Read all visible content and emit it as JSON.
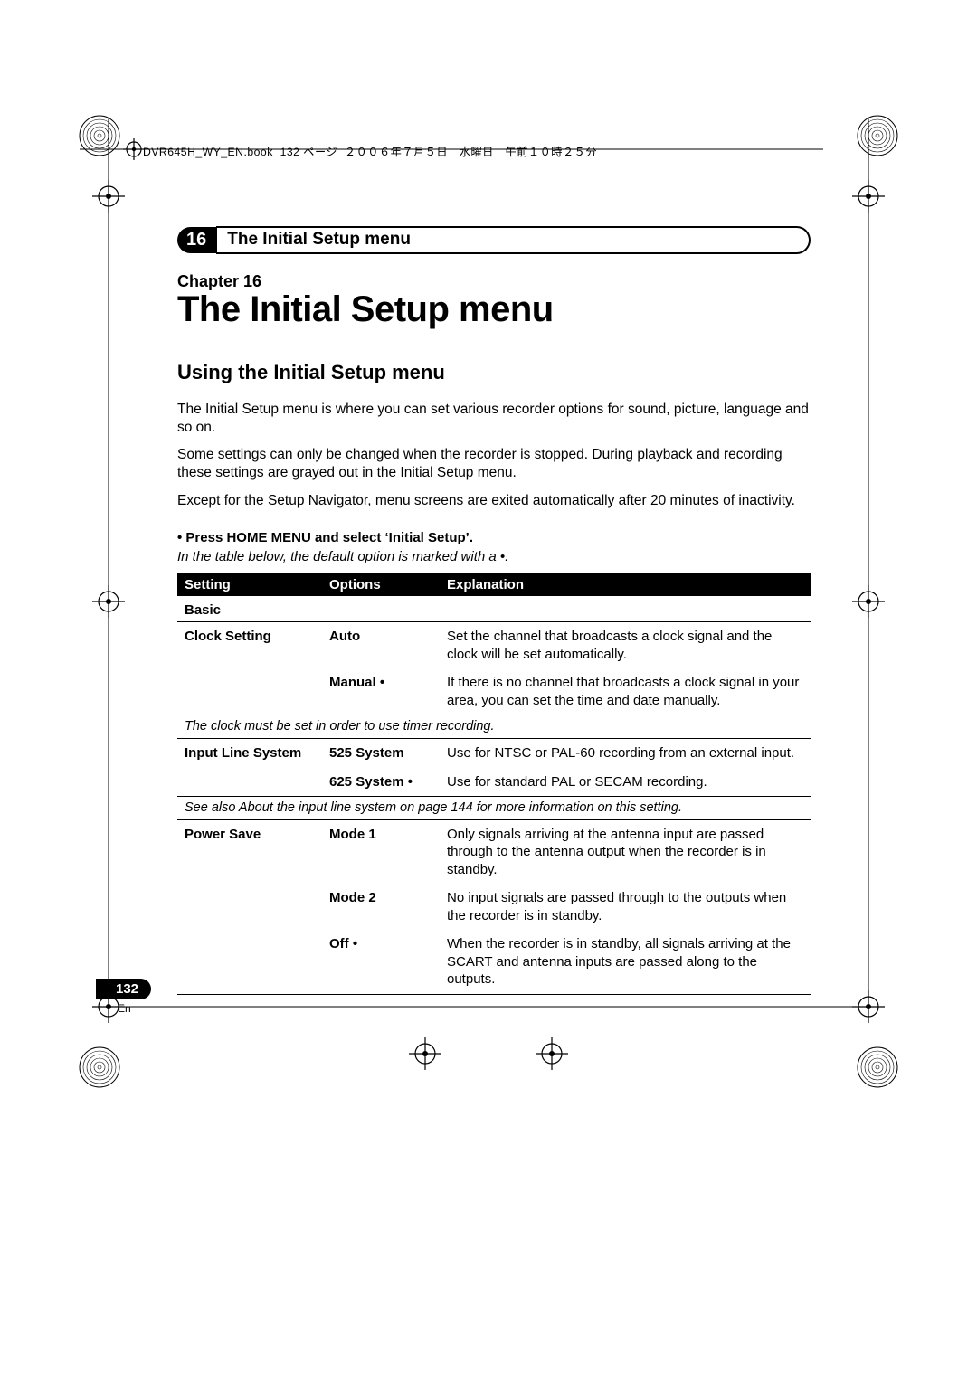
{
  "meta": {
    "book_line": "DVR645H_WY_EN.book  132 ページ  ２００６年７月５日　水曜日　午前１０時２５分"
  },
  "header": {
    "chapter_number": "16",
    "chapter_breadcrumb": "The Initial Setup menu",
    "chapter_label": "Chapter 16",
    "chapter_title": "The Initial Setup menu"
  },
  "section": {
    "title": "Using the Initial Setup menu",
    "paragraphs": [
      "The Initial Setup menu is where you can set various recorder options for sound, picture, language and so on.",
      "Some settings can only be changed when the recorder is stopped. During playback and recording these settings are grayed out in the Initial Setup menu.",
      "Except for the Setup Navigator, menu screens are exited automatically after 20 minutes of inactivity."
    ],
    "bullet": "•   Press HOME MENU and select ‘Initial Setup’.",
    "table_note": "In the table below, the default option is marked with a  •."
  },
  "table": {
    "columns": [
      "Setting",
      "Options",
      "Explanation"
    ],
    "section_basic": "Basic",
    "rows": {
      "clock": {
        "label": "Clock Setting",
        "opt_auto": "Auto",
        "exp_auto": "Set the channel that broadcasts a clock signal and the clock will be set automatically.",
        "opt_manual": "Manual •",
        "exp_manual": "If there is no channel that broadcasts a clock signal in your area, you can set the time and date manually.",
        "note": "The clock must be set in order to use timer recording."
      },
      "input_line": {
        "label": "Input Line System",
        "opt_525": "525 System",
        "exp_525": "Use for NTSC or PAL-60 recording from an external input.",
        "opt_625": "625 System •",
        "exp_625": "Use for standard PAL or SECAM recording.",
        "note": "See also About the input line system on page 144 for more information on this setting."
      },
      "power_save": {
        "label": "Power Save",
        "opt_mode1": "Mode 1",
        "exp_mode1": "Only signals arriving at the antenna input are passed through to the antenna output when the recorder is in standby.",
        "opt_mode2": "Mode 2",
        "exp_mode2": "No input signals are passed through to the outputs when the recorder is in standby.",
        "opt_off": "Off •",
        "exp_off": "When the recorder is in standby, all signals arriving at the SCART and antenna inputs are passed along to the outputs."
      }
    }
  },
  "footer": {
    "page_number": "132",
    "lang": "En"
  }
}
